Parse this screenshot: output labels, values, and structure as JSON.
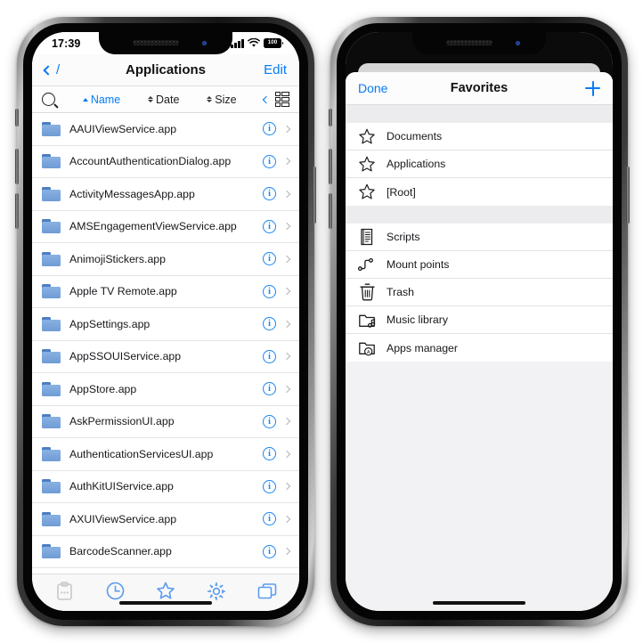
{
  "left_phone": {
    "status_bar": {
      "time": "17:39",
      "battery_level": "100",
      "wifi_icon": "wifi-icon",
      "cellular_icon": "cellular-bars-icon"
    },
    "nav_bar": {
      "back_label": "/",
      "title": "Applications",
      "edit_label": "Edit"
    },
    "sort_bar": {
      "search_icon": "search-icon",
      "sorts": [
        {
          "label": "Name",
          "active": true,
          "direction": "asc"
        },
        {
          "label": "Date",
          "active": false,
          "direction": "none"
        },
        {
          "label": "Size",
          "active": false,
          "direction": "none"
        }
      ],
      "collapse_icon": "chevron-left-icon",
      "view_mode_icon": "list-view-icon"
    },
    "files": [
      {
        "name": "AAUIViewService.app",
        "type": "folder"
      },
      {
        "name": "AccountAuthenticationDialog.app",
        "type": "folder"
      },
      {
        "name": "ActivityMessagesApp.app",
        "type": "folder"
      },
      {
        "name": "AMSEngagementViewService.app",
        "type": "folder"
      },
      {
        "name": "AnimojiStickers.app",
        "type": "folder"
      },
      {
        "name": "Apple TV Remote.app",
        "type": "folder"
      },
      {
        "name": "AppSettings.app",
        "type": "folder"
      },
      {
        "name": "AppSSOUIService.app",
        "type": "folder"
      },
      {
        "name": "AppStore.app",
        "type": "folder"
      },
      {
        "name": "AskPermissionUI.app",
        "type": "folder"
      },
      {
        "name": "AuthenticationServicesUI.app",
        "type": "folder"
      },
      {
        "name": "AuthKitUIService.app",
        "type": "folder"
      },
      {
        "name": "AXUIViewService.app",
        "type": "folder"
      },
      {
        "name": "BarcodeScanner.app",
        "type": "folder"
      }
    ],
    "tab_bar": [
      {
        "icon": "clipboard-icon",
        "state": "disabled"
      },
      {
        "icon": "clock-recents-icon",
        "state": "enabled"
      },
      {
        "icon": "star-favorites-icon",
        "state": "enabled"
      },
      {
        "icon": "gear-settings-icon",
        "state": "enabled"
      },
      {
        "icon": "windows-tabs-icon",
        "state": "enabled"
      }
    ]
  },
  "right_phone": {
    "sheet": {
      "done_label": "Done",
      "title": "Favorites",
      "add_icon": "plus-icon"
    },
    "favorites": [
      {
        "label": "Documents",
        "icon": "star-icon"
      },
      {
        "label": "Applications",
        "icon": "star-icon"
      },
      {
        "label": "[Root]",
        "icon": "star-icon"
      }
    ],
    "shortcuts": [
      {
        "label": "Scripts",
        "icon": "scroll-script-icon"
      },
      {
        "label": "Mount points",
        "icon": "mount-points-icon"
      },
      {
        "label": "Trash",
        "icon": "trash-icon"
      },
      {
        "label": "Music library",
        "icon": "folder-music-icon"
      },
      {
        "label": "Apps manager",
        "icon": "folder-apps-icon"
      }
    ]
  },
  "colors": {
    "accent_blue": "#067bf5",
    "folder_blue": "#7aa6dd",
    "folder_tab": "#4d7fc0",
    "info_blue": "#1886f0",
    "sheet_bg": "#f2f2f4",
    "separator": "#e4e4e4"
  }
}
